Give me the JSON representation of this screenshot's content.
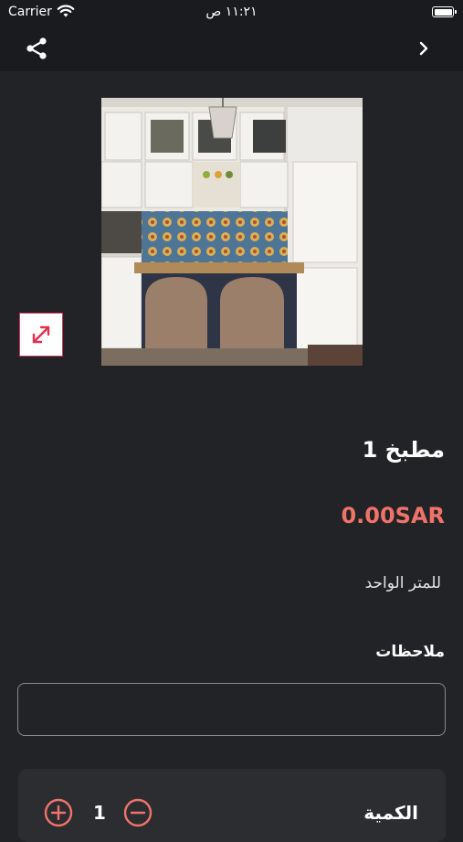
{
  "status_bar": {
    "carrier": "Carrier",
    "time": "١١:٢١ ص"
  },
  "nav": {
    "share_icon": "share-icon",
    "forward_icon": "chevron-right-icon"
  },
  "product": {
    "title": "مطبخ 1",
    "price": "0.00SAR",
    "unit": "للمتر الواحد",
    "image_alt": "kitchen photo"
  },
  "notes": {
    "label": "ملاحظات",
    "value": "",
    "placeholder": ""
  },
  "quantity": {
    "label": "الكمية",
    "value": "1"
  },
  "colors": {
    "background": "#222326",
    "bar": "#1a1b1e",
    "price": "#f0736a",
    "accent": "#d33c52"
  }
}
